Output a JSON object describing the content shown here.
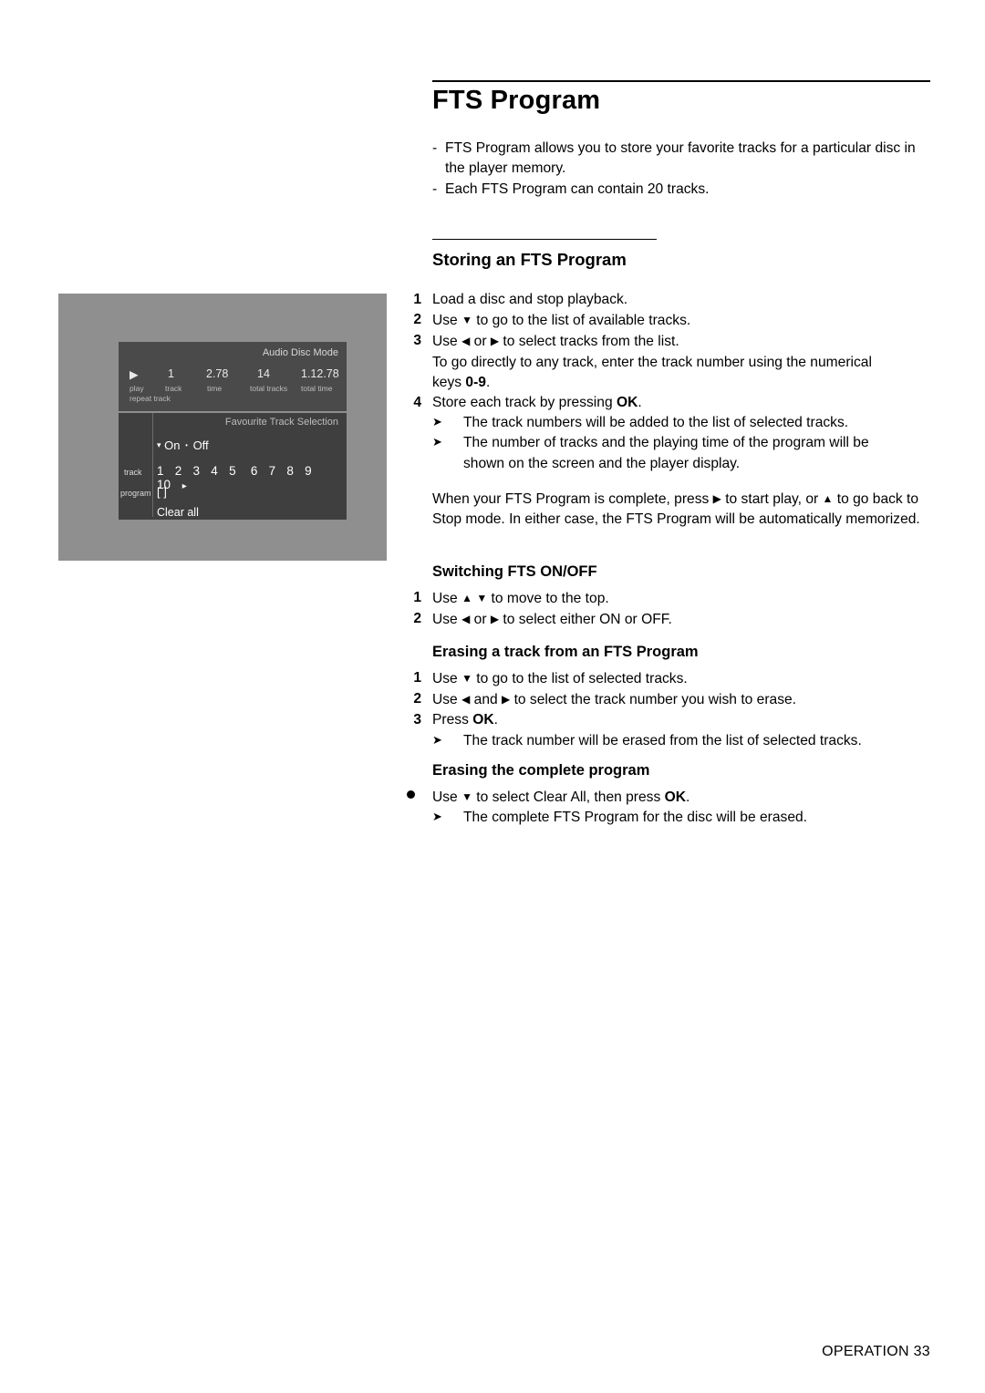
{
  "page": {
    "title": "FTS Program",
    "footer": "OPERATION  33"
  },
  "intro": {
    "items": [
      "FTS Program allows you to store your favorite tracks for a particular disc in the player memory.",
      "Each FTS Program can contain 20 tracks."
    ]
  },
  "storing": {
    "heading": "Storing an FTS Program",
    "steps": [
      {
        "num": "1",
        "text": "Load a disc and stop playback."
      },
      {
        "num": "2",
        "text": "Use ▼ to go to the list of available tracks."
      },
      {
        "num": "3",
        "text": "Use ◀ or ▶ to select tracks from the list."
      },
      {
        "num": "",
        "text": "To go directly to any track, enter the track number using the numerical keys 0-9."
      },
      {
        "num": "4",
        "text": "Store each track by pressing OK."
      }
    ],
    "substeps": [
      "The track numbers will be added to the list of selected tracks.",
      "The number of tracks and the playing time of the program will be shown on the screen and the player display."
    ],
    "paragraph": "When your FTS Program is complete, press ▶ to start play, or ▲ to go back to Stop mode. In either case, the FTS Program will be automatically memorized."
  },
  "switching": {
    "heading": "Switching FTS ON/OFF",
    "steps": [
      {
        "num": "1",
        "text": "Use ▲ ▼ to move to the top."
      },
      {
        "num": "2",
        "text": "Use ◀ or ▶ to select either ON or OFF."
      }
    ]
  },
  "erasing_track": {
    "heading": "Erasing a track from an FTS Program",
    "steps": [
      {
        "num": "1",
        "text": "Use ▼ to go to the list of selected tracks."
      },
      {
        "num": "2",
        "text": "Use ◀ and ▶ to select the track number you wish to erase."
      },
      {
        "num": "3",
        "text": "Press OK."
      }
    ],
    "substeps": [
      "The track number will be erased from the list of selected tracks."
    ]
  },
  "erasing_program": {
    "heading": "Erasing the complete program",
    "steps": [
      {
        "num": "●",
        "text": "Use ▼ to select Clear All, then press OK."
      }
    ],
    "substeps": [
      "The complete FTS Program for the disc will be erased."
    ]
  },
  "osd": {
    "mode_label": "Audio Disc Mode",
    "play_icon": "play-icon",
    "status": {
      "track": "1",
      "time": "2.78",
      "total_tracks": "14",
      "total_time": "1.12.78"
    },
    "status_labels": {
      "play": "play",
      "track": "track",
      "time": "time",
      "total_tracks": "total tracks",
      "total_time": "total time",
      "repeat_track": "repeat track"
    },
    "fts_title": "Favourite Track Selection",
    "onoff": {
      "on": "On",
      "off": "Off",
      "caret": "▾",
      "dot": "•"
    },
    "rows": {
      "track_label": "track",
      "program_label": "program",
      "tracks": [
        "1",
        "2",
        "3",
        "4",
        "5",
        "6",
        "7",
        "8",
        "9",
        "10"
      ],
      "more_arrow": "▸",
      "program_value": "[ ]",
      "clear_all": "Clear all"
    }
  }
}
